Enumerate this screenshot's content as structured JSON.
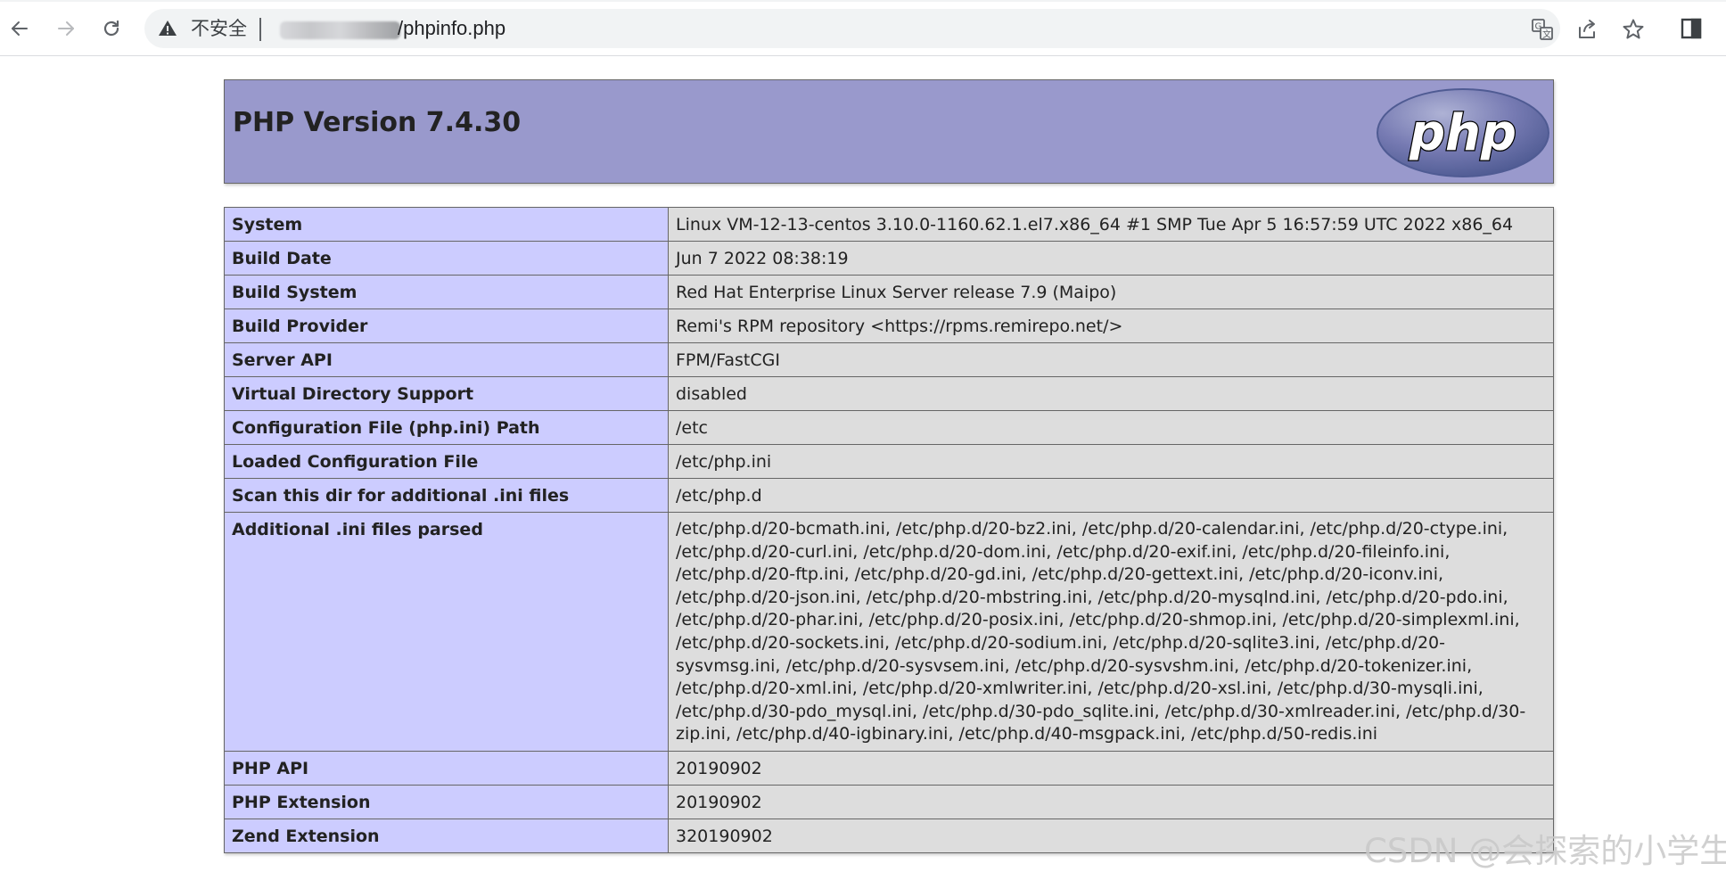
{
  "browser": {
    "security_label": "不安全",
    "url_path": "/phpinfo.php"
  },
  "header": {
    "title": "PHP Version 7.4.30",
    "logo": "php"
  },
  "info_rows": [
    {
      "key": "System",
      "value": "Linux VM-12-13-centos 3.10.0-1160.62.1.el7.x86_64 #1 SMP Tue Apr 5 16:57:59 UTC 2022 x86_64"
    },
    {
      "key": "Build Date",
      "value": "Jun 7 2022 08:38:19"
    },
    {
      "key": "Build System",
      "value": "Red Hat Enterprise Linux Server release 7.9 (Maipo)"
    },
    {
      "key": "Build Provider",
      "value": "Remi's RPM repository <https://rpms.remirepo.net/>"
    },
    {
      "key": "Server API",
      "value": "FPM/FastCGI"
    },
    {
      "key": "Virtual Directory Support",
      "value": "disabled"
    },
    {
      "key": "Configuration File (php.ini) Path",
      "value": "/etc"
    },
    {
      "key": "Loaded Configuration File",
      "value": "/etc/php.ini"
    },
    {
      "key": "Scan this dir for additional .ini files",
      "value": "/etc/php.d"
    },
    {
      "key": "Additional .ini files parsed",
      "value": "/etc/php.d/20-bcmath.ini, /etc/php.d/20-bz2.ini, /etc/php.d/20-calendar.ini, /etc/php.d/20-ctype.ini, /etc/php.d/20-curl.ini, /etc/php.d/20-dom.ini, /etc/php.d/20-exif.ini, /etc/php.d/20-fileinfo.ini, /etc/php.d/20-ftp.ini, /etc/php.d/20-gd.ini, /etc/php.d/20-gettext.ini, /etc/php.d/20-iconv.ini, /etc/php.d/20-json.ini, /etc/php.d/20-mbstring.ini, /etc/php.d/20-mysqlnd.ini, /etc/php.d/20-pdo.ini, /etc/php.d/20-phar.ini, /etc/php.d/20-posix.ini, /etc/php.d/20-shmop.ini, /etc/php.d/20-simplexml.ini, /etc/php.d/20-sockets.ini, /etc/php.d/20-sodium.ini, /etc/php.d/20-sqlite3.ini, /etc/php.d/20-sysvmsg.ini, /etc/php.d/20-sysvsem.ini, /etc/php.d/20-sysvshm.ini, /etc/php.d/20-tokenizer.ini, /etc/php.d/20-xml.ini, /etc/php.d/20-xmlwriter.ini, /etc/php.d/20-xsl.ini, /etc/php.d/30-mysqli.ini, /etc/php.d/30-pdo_mysql.ini, /etc/php.d/30-pdo_sqlite.ini, /etc/php.d/30-xmlreader.ini, /etc/php.d/30-zip.ini, /etc/php.d/40-igbinary.ini, /etc/php.d/40-msgpack.ini, /etc/php.d/50-redis.ini"
    },
    {
      "key": "PHP API",
      "value": "20190902"
    },
    {
      "key": "PHP Extension",
      "value": "20190902"
    },
    {
      "key": "Zend Extension",
      "value": "320190902"
    }
  ],
  "watermark": "CSDN @会探索的小学生",
  "colors": {
    "header_bg": "#9999cc",
    "key_cell_bg": "#ccccff",
    "value_cell_bg": "#dddddd",
    "border": "#666666",
    "logo_bg": "#777bb3"
  }
}
